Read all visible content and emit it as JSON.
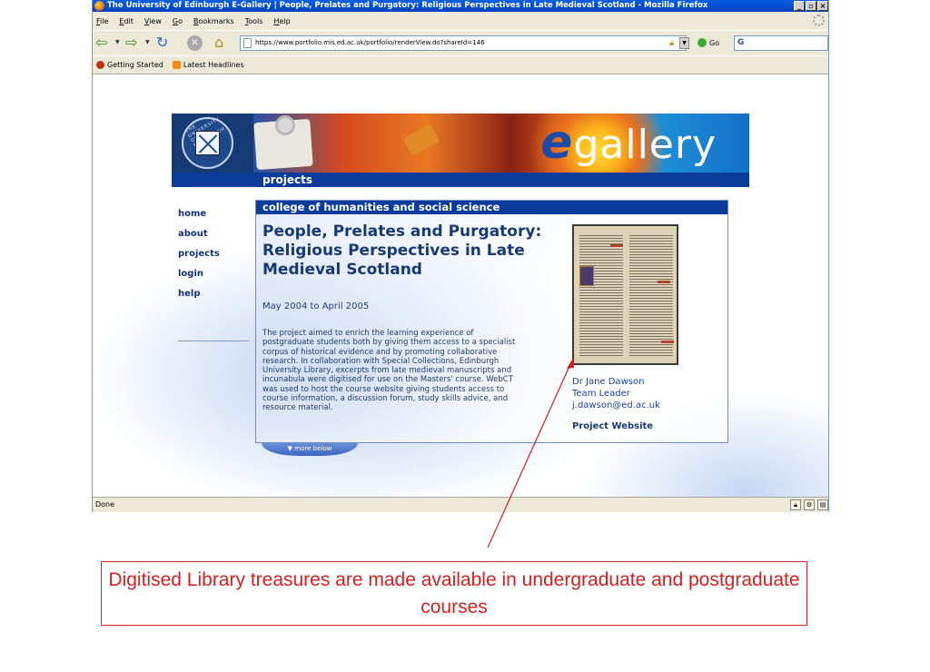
{
  "browser": {
    "title": "The University of Edinburgh E-Gallery | People, Prelates and Purgatory: Religious Perspectives in Late Medieval Scotland - Mozilla Firefox",
    "menu": [
      "File",
      "Edit",
      "View",
      "Go",
      "Bookmarks",
      "Tools",
      "Help"
    ],
    "url": "https://www.portfolio.mis.ed.ac.uk/portfolio/renderView.do?shareId=146",
    "go_label": "Go",
    "search_placeholder": "G",
    "bookmarks": [
      "Getting Started",
      "Latest Headlines"
    ],
    "status": "Done"
  },
  "banner": {
    "crest_text": "THE UNIVERSITY OF EDINBURGH",
    "logo_e": "e",
    "logo_word": "gallery",
    "section": "projects"
  },
  "nav": {
    "items": [
      "home",
      "about",
      "projects",
      "login",
      "help"
    ]
  },
  "panel": {
    "college": "college of humanities and social science",
    "title": "People, Prelates and Purgatory: Religious Perspectives in Late Medieval Scotland",
    "dates": "May 2004 to April 2005",
    "description": "The project aimed to enrich the learning experience of postgraduate students both by giving them access to a specialist corpus of historical evidence and by promoting collaborative research. In collaboration with Special Collections, Edinburgh University Library, excerpts from late medieval manuscripts and incunabula were digitised for use on the Masters' course. WebCT was used to host the course website giving students access to course information, a discussion forum, study skills advice, and resource material.",
    "contact_name": "Dr Jane Dawson",
    "contact_role": "Team Leader",
    "contact_email": "j.dawson@ed.ac.uk",
    "website_link": "Project Website",
    "more_below": "more below"
  },
  "annotation": {
    "caption": "Digitised Library treasures are made available in undergraduate and postgraduate courses",
    "color": "#d42020"
  }
}
